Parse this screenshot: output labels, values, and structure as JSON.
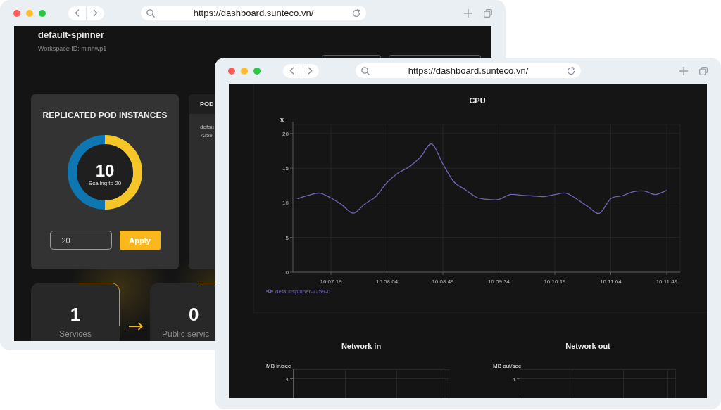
{
  "back_window": {
    "url": "https://dashboard.sunteco.vn/",
    "workspace": {
      "name": "default-spinner",
      "id_label": "Workspace ID: minhwp1"
    },
    "replicas": {
      "title": "REPLICATED POD INSTANCES",
      "count": "10",
      "caption": "Scaling to 20",
      "level": 0.5,
      "input_value": "20",
      "button": "Apply"
    },
    "pod_card": {
      "header": "POD",
      "lines": [
        "defau",
        "7259-"
      ]
    },
    "stats": [
      {
        "value": "1",
        "label": "Services"
      },
      {
        "value": "0",
        "label": "Public servic"
      }
    ]
  },
  "front_window": {
    "url": "https://dashboard.sunteco.vn/",
    "cpu": {
      "chart_data": {
        "type": "line",
        "title": "CPU",
        "ylabel": "%",
        "categories": [
          null,
          null,
          null,
          "16:07:19",
          null,
          null,
          null,
          null,
          "16:08:04",
          null,
          null,
          null,
          null,
          "16:08:49",
          null,
          null,
          null,
          null,
          "16:09:34",
          null,
          null,
          null,
          null,
          "16:10:19",
          null,
          null,
          null,
          null,
          "16:11:04",
          null,
          null,
          null,
          null,
          "16:11:49"
        ],
        "series": [
          {
            "name": "defaultspinner-7259-0",
            "color": "#6e66b4",
            "values": [
              10.6,
              11.1,
              11.4,
              10.7,
              9.7,
              8.5,
              9.8,
              10.9,
              12.9,
              14.3,
              15.2,
              16.6,
              18.5,
              15.6,
              13.0,
              11.9,
              10.8,
              10.5,
              10.5,
              11.2,
              11.1,
              11.0,
              10.9,
              11.2,
              11.4,
              10.5,
              9.4,
              8.5,
              10.6,
              11.0,
              11.6,
              11.7,
              11.2,
              11.8
            ]
          }
        ],
        "ylim": [
          0,
          21.3
        ],
        "yticks": [
          0,
          5,
          10,
          15,
          20
        ],
        "grid": true
      }
    },
    "network_charts": [
      {
        "title": "Network in",
        "ylabel": "MB in/sec",
        "ytick": "4"
      },
      {
        "title": "Network out",
        "ylabel": "MB out/sec",
        "ytick": "4"
      }
    ]
  }
}
